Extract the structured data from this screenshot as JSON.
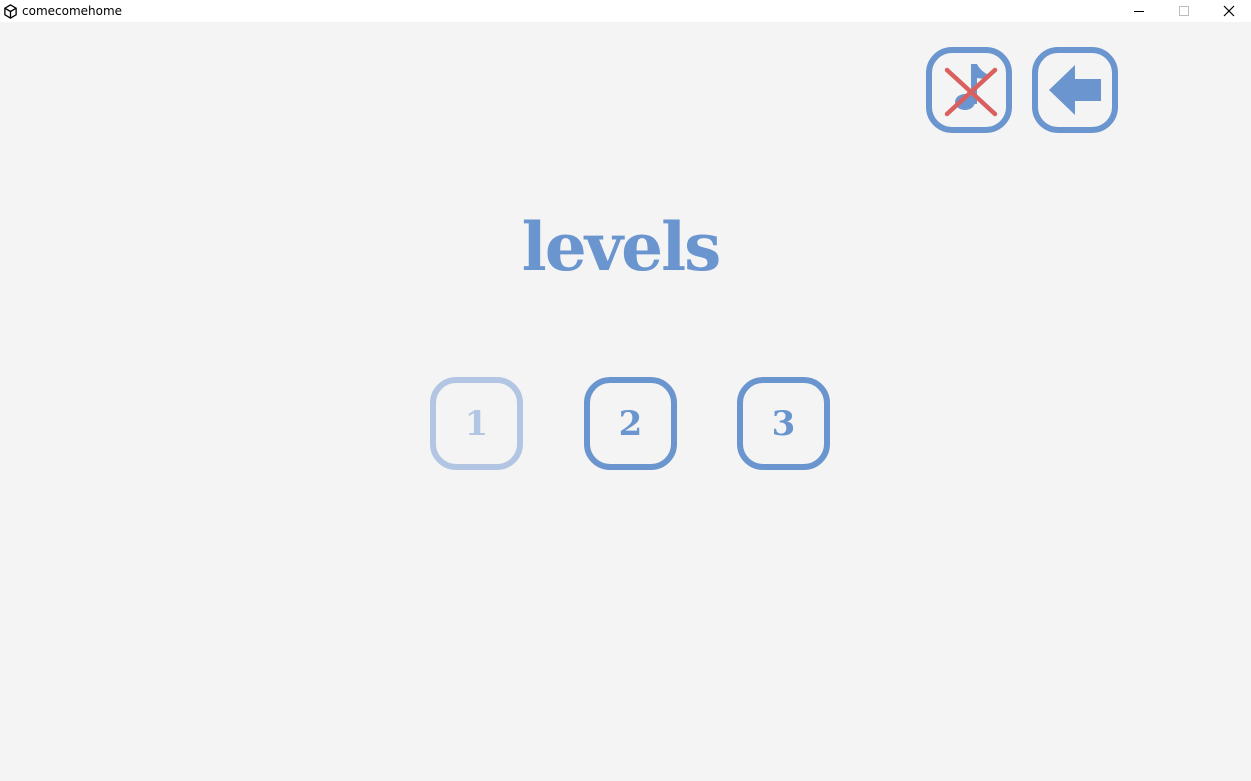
{
  "window": {
    "title": "comecomehome",
    "app_icon": "unity-logo-icon",
    "controls": [
      "minimize-icon",
      "maximize-icon",
      "close-icon"
    ]
  },
  "toolbar": {
    "mute_button": {
      "icon": "music-note-muted-icon",
      "state": "muted"
    },
    "back_button": {
      "icon": "arrow-left-icon"
    }
  },
  "main": {
    "title": "levels",
    "levels": [
      {
        "label": "1",
        "state": "locked"
      },
      {
        "label": "2",
        "state": "unlocked"
      },
      {
        "label": "3",
        "state": "unlocked"
      }
    ]
  },
  "colors": {
    "accent": "#6a95cf",
    "accent_faded": "#b2c6e4",
    "mute_cross": "#d9605e",
    "background": "#f4f4f4"
  }
}
